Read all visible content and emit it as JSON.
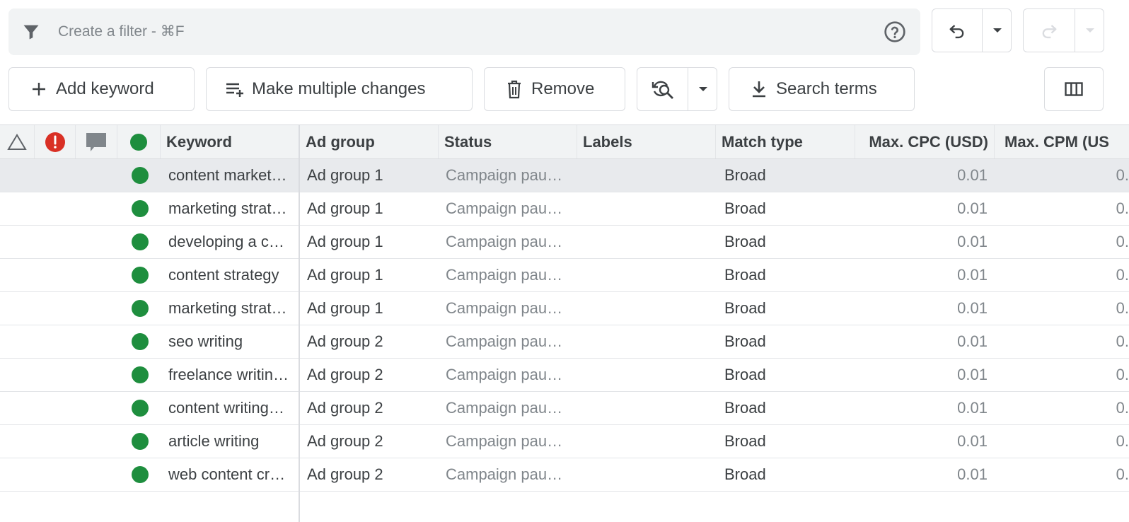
{
  "filter": {
    "placeholder": "Create a filter - ⌘F",
    "icon": "filter-icon",
    "help_icon": "help-circle-icon"
  },
  "history": {
    "undo_icon": "undo-icon",
    "redo_icon": "redo-icon"
  },
  "toolbar": {
    "add_keyword": "Add keyword",
    "make_multiple_changes": "Make multiple changes",
    "remove": "Remove",
    "search_terms": "Search terms",
    "icons": [
      "add-icon",
      "playlist-add-icon",
      "trash-icon",
      "refresh-search-icon",
      "download-icon",
      "columns-icon"
    ]
  },
  "table": {
    "headers": {
      "keyword": "Keyword",
      "ad_group": "Ad group",
      "status": "Status",
      "labels": "Labels",
      "match_type": "Match type",
      "max_cpc": "Max. CPC (USD)",
      "max_cpm": "Max. CPM (US"
    },
    "rows": [
      {
        "keyword": "content market…",
        "ad_group": "Ad group 1",
        "status": "Campaign pau…",
        "labels": "",
        "match_type": "Broad",
        "max_cpc": "0.01",
        "max_cpm": "0."
      },
      {
        "keyword": "marketing strat…",
        "ad_group": "Ad group 1",
        "status": "Campaign pau…",
        "labels": "",
        "match_type": "Broad",
        "max_cpc": "0.01",
        "max_cpm": "0."
      },
      {
        "keyword": "developing a c…",
        "ad_group": "Ad group 1",
        "status": "Campaign pau…",
        "labels": "",
        "match_type": "Broad",
        "max_cpc": "0.01",
        "max_cpm": "0."
      },
      {
        "keyword": "content strategy",
        "ad_group": "Ad group 1",
        "status": "Campaign pau…",
        "labels": "",
        "match_type": "Broad",
        "max_cpc": "0.01",
        "max_cpm": "0."
      },
      {
        "keyword": "marketing strat…",
        "ad_group": "Ad group 1",
        "status": "Campaign pau…",
        "labels": "",
        "match_type": "Broad",
        "max_cpc": "0.01",
        "max_cpm": "0."
      },
      {
        "keyword": "seo writing",
        "ad_group": "Ad group 2",
        "status": "Campaign pau…",
        "labels": "",
        "match_type": "Broad",
        "max_cpc": "0.01",
        "max_cpm": "0."
      },
      {
        "keyword": "freelance writin…",
        "ad_group": "Ad group 2",
        "status": "Campaign pau…",
        "labels": "",
        "match_type": "Broad",
        "max_cpc": "0.01",
        "max_cpm": "0."
      },
      {
        "keyword": "content writing…",
        "ad_group": "Ad group 2",
        "status": "Campaign pau…",
        "labels": "",
        "match_type": "Broad",
        "max_cpc": "0.01",
        "max_cpm": "0."
      },
      {
        "keyword": "article writing",
        "ad_group": "Ad group 2",
        "status": "Campaign pau…",
        "labels": "",
        "match_type": "Broad",
        "max_cpc": "0.01",
        "max_cpm": "0."
      },
      {
        "keyword": "web content cr…",
        "ad_group": "Ad group 2",
        "status": "Campaign pau…",
        "labels": "",
        "match_type": "Broad",
        "max_cpc": "0.01",
        "max_cpm": "0."
      }
    ]
  },
  "colors": {
    "enabled_dot": "#1e8e3e",
    "error_badge": "#d93025",
    "selected_row": "#e8eaed",
    "header_bg": "#f1f3f4"
  }
}
